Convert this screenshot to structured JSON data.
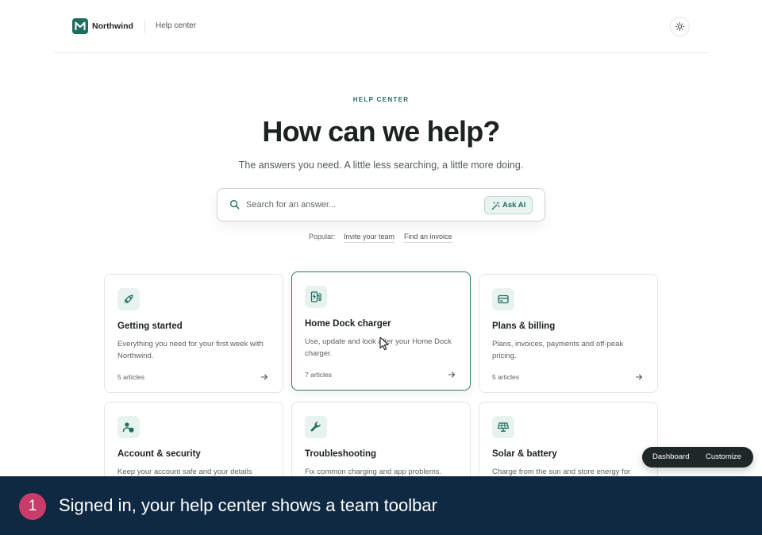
{
  "header": {
    "brand": "Northwind",
    "nav_link": "Help center"
  },
  "hero": {
    "eyebrow": "HELP CENTER",
    "title": "How can we help?",
    "subtitle": "The answers you need. A little less searching, a little more doing."
  },
  "search": {
    "placeholder": "Search for an answer...",
    "value": "",
    "ask_ai_label": "Ask AI"
  },
  "popular": {
    "label": "Popular:",
    "links": [
      "Invite your team",
      "Find an invoice"
    ]
  },
  "cards": [
    {
      "title": "Getting started",
      "description": "Everything you need for your first week with Northwind.",
      "count": "5 articles",
      "icon": "rocket-icon"
    },
    {
      "title": "Home Dock charger",
      "description": "Use, update and look after your Home Dock charger.",
      "count": "7 articles",
      "icon": "ev-charger-icon"
    },
    {
      "title": "Plans & billing",
      "description": "Plans, invoices, payments and off-peak pricing.",
      "count": "5 articles",
      "icon": "credit-card-icon"
    },
    {
      "title": "Account & security",
      "description": "Keep your account safe and your details",
      "count": "",
      "icon": "user-shield-icon"
    },
    {
      "title": "Troubleshooting",
      "description": "Fix common charging and app problems.",
      "count": "",
      "icon": "wrench-icon"
    },
    {
      "title": "Solar & battery",
      "description": "Charge from the sun and store energy for",
      "count": "",
      "icon": "solar-panel-icon"
    }
  ],
  "toolbar": {
    "dashboard_label": "Dashboard",
    "customize_label": "Customize"
  },
  "caption": {
    "step": "1",
    "text": "Signed in, your help center shows a team toolbar"
  },
  "colors": {
    "accent": "#1c6e5e",
    "accent_soft": "#e8f3f0",
    "caption_bg": "#0f2942",
    "step_badge": "#c93b69",
    "toolbar_bg": "#1e2826"
  }
}
